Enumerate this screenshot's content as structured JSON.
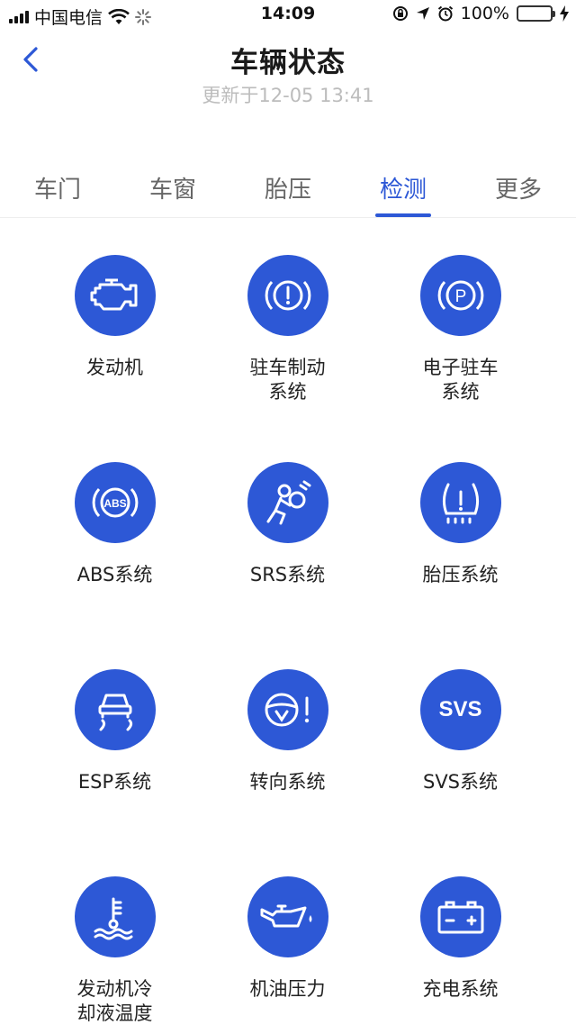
{
  "status_bar": {
    "carrier": "中国电信",
    "time": "14:09",
    "battery": "100%"
  },
  "header": {
    "title": "车辆状态",
    "updated": "更新于12-05 13:41"
  },
  "tabs": [
    {
      "label": "车门"
    },
    {
      "label": "车窗"
    },
    {
      "label": "胎压"
    },
    {
      "label": "检测"
    },
    {
      "label": "更多"
    }
  ],
  "active_tab": "检测",
  "accent_color": "#2d58d6",
  "items": [
    {
      "icon": "engine-icon",
      "line1": "发动机",
      "line2": ""
    },
    {
      "icon": "parking-brake-warning-icon",
      "line1": "驻车制动",
      "line2": "系统"
    },
    {
      "icon": "electronic-parking-icon",
      "line1": "电子驻车",
      "line2": "系统"
    },
    {
      "icon": "abs-icon",
      "line1": "ABS系统",
      "line2": ""
    },
    {
      "icon": "airbag-icon",
      "line1": "SRS系统",
      "line2": ""
    },
    {
      "icon": "tire-pressure-icon",
      "line1": "胎压系统",
      "line2": ""
    },
    {
      "icon": "esp-skid-icon",
      "line1": "ESP系统",
      "line2": ""
    },
    {
      "icon": "steering-warning-icon",
      "line1": "转向系统",
      "line2": ""
    },
    {
      "icon": "svs-icon",
      "line1": "SVS系统",
      "line2": ""
    },
    {
      "icon": "coolant-temp-icon",
      "line1": "发动机冷",
      "line2": "却液温度"
    },
    {
      "icon": "oil-pressure-icon",
      "line1": "机油压力",
      "line2": ""
    },
    {
      "icon": "battery-charge-icon",
      "line1": "充电系统",
      "line2": ""
    }
  ],
  "icon_text": {
    "abs": "ABS",
    "parking": "P",
    "svs": "SVS"
  }
}
